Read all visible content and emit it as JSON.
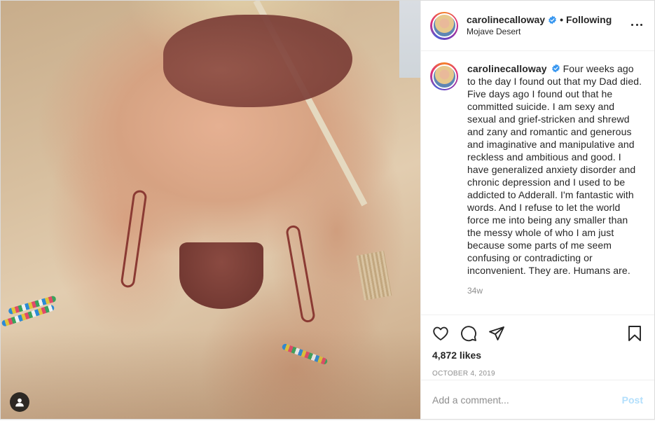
{
  "post": {
    "username": "carolinecalloway",
    "verified_icon": "verified-badge-icon",
    "separator": "•",
    "follow_status": "Following",
    "location": "Mojave Desert",
    "caption": "Four weeks ago to the day I found out that my Dad died. Five days ago I found out that he committed suicide. I am sexy and sexual and grief-stricken and shrewd and zany and romantic and generous and imaginative and manipulative and reckless and ambitious and good. I have generalized anxiety disorder and chronic depression and I used to be addicted to Adderall. I'm fantastic with words. And I refuse to let the world force me into being any smaller than the messy whole of who I am just because some parts of me seem confusing or contradicting or inconvenient. They are. Humans are.",
    "time_ago": "34w",
    "likes": "4,872 likes",
    "date": "OCTOBER 4, 2019"
  },
  "actions": {
    "icons": [
      "heart-icon",
      "comment-icon",
      "share-icon",
      "bookmark-icon"
    ]
  },
  "comment_box": {
    "placeholder": "Add a comment...",
    "post_label": "Post"
  },
  "colors": {
    "verified_blue": "#3897f0",
    "post_button_disabled": "#b2dffc",
    "muted_text": "#8e8e8e",
    "border": "#efefef"
  }
}
